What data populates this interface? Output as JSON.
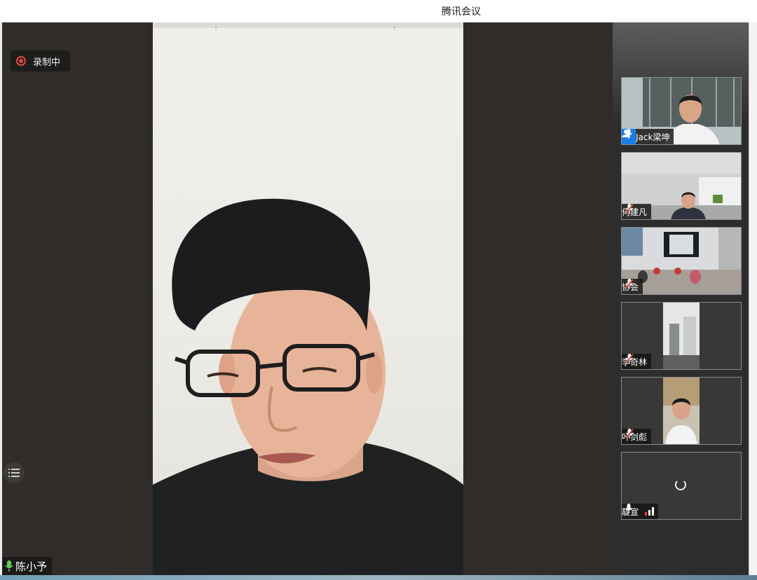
{
  "window": {
    "title": "腾讯会议"
  },
  "recording": {
    "label": "录制中"
  },
  "main_speaker": {
    "name": "陈小予"
  },
  "participants": [
    {
      "name": "Jack梁坤",
      "role": "host",
      "mic": "on"
    },
    {
      "name": "何建凡",
      "mic": "muted"
    },
    {
      "name": "协会",
      "mic": "muted"
    },
    {
      "name": "李奇林",
      "mic": "muted"
    },
    {
      "name": "叶剑彪",
      "mic": "muted"
    },
    {
      "name": "靛宣",
      "mic": "on",
      "video": "loading",
      "signal": "3 bars"
    }
  ],
  "colors": {
    "accent_blue": "#1a7ee8",
    "recording_red": "#e04a43",
    "mic_active": "#5fd15b"
  }
}
